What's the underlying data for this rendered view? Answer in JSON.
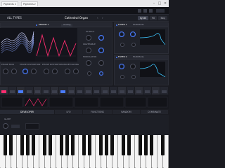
{
  "titlebar": {
    "tab1": "Pigments 2",
    "tab2": "Pigments 2"
  },
  "toolbar": {
    "browser_label": "ALL TYPES",
    "preset_name": "Cathedral Organ"
  },
  "nav": {
    "synth": "Synth",
    "fx": "FX",
    "seq": "Seq"
  },
  "engine1": {
    "label": "ENGINE 1",
    "mode": "Analog"
  },
  "filter1": {
    "label": "FILTER 1",
    "type": "MultiMode"
  },
  "filter2": {
    "label": "FILTER 2",
    "type": "MultiMode"
  },
  "sections": {
    "output": "OUTPUT",
    "modulator": "MODULATOR",
    "wavetable": "WAVETABLE",
    "phase_mod": "PHASE MOD",
    "phase_distortion": "PHASE DISTORTION",
    "wavefolding": "WAVEFOLDING"
  },
  "mod_tabs": [
    "DEVELOPER",
    "LFO",
    "FUNCTIONS",
    "RANDOM",
    "COMBINATE"
  ],
  "mod_labels": [
    "GLIDE"
  ],
  "accent_color": "#4a7cff"
}
